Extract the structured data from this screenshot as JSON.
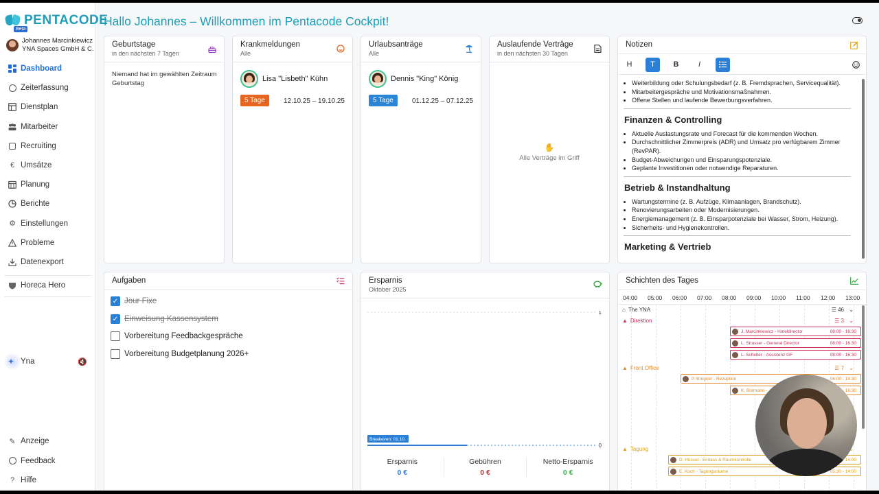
{
  "brand": {
    "name": "PENTACODE",
    "beta": "Beta"
  },
  "user": {
    "name": "Johannes Marcinkiewicz",
    "company": "YNA Spaces GmbH & C..."
  },
  "nav": [
    {
      "label": "Dashboard",
      "icon": "dashboard-icon",
      "active": true
    },
    {
      "label": "Zeiterfassung",
      "icon": "stopwatch-icon"
    },
    {
      "label": "Dienstplan",
      "icon": "table-icon"
    },
    {
      "label": "Mitarbeiter",
      "icon": "users-icon"
    },
    {
      "label": "Recruiting",
      "icon": "contact-icon"
    },
    {
      "label": "Umsätze",
      "icon": "euro-icon"
    },
    {
      "label": "Planung",
      "icon": "calendar-icon"
    },
    {
      "label": "Berichte",
      "icon": "pie-chart-icon"
    },
    {
      "label": "Einstellungen",
      "icon": "gear-icon"
    },
    {
      "label": "Probleme",
      "icon": "warning-icon"
    },
    {
      "label": "Datenexport",
      "icon": "download-icon"
    }
  ],
  "integration": {
    "label": "Horeca Hero",
    "icon": "shield-icon"
  },
  "assistant": {
    "label": "Yna",
    "icon": "sparkle-icon",
    "mute_icon": "mute-icon"
  },
  "bottom_nav": [
    {
      "label": "Anzeige",
      "icon": "brush-icon"
    },
    {
      "label": "Feedback",
      "icon": "chat-icon"
    },
    {
      "label": "Hilfe",
      "icon": "question-icon"
    }
  ],
  "page": {
    "title": "Hallo Johannes – Willkommen im Pentacode Cockpit!",
    "theme_icon": "toggle-icon"
  },
  "cards": {
    "birthdays": {
      "title": "Geburtstage",
      "subtitle": "in den nächsten 7 Tagen",
      "empty": "Niemand hat im gewählten Zeitraum Geburtstag",
      "icon": "cake-icon",
      "color": "#9b3fc7"
    },
    "sick": {
      "title": "Krankmeldungen",
      "subtitle": "Alle",
      "person": "Lisa \"Lisbeth\" Kühn",
      "badge": "5 Tage",
      "badge_color": "#e8651f",
      "range": "12.10.25 – 19.10.25",
      "icon": "sick-face-icon",
      "color": "#e8651f"
    },
    "vacation": {
      "title": "Urlaubsanträge",
      "subtitle": "Alle",
      "person": "Dennis \"King\" König",
      "badge": "5 Tage",
      "badge_color": "#2a85d6",
      "range": "01.12.25 – 07.12.25",
      "icon": "beach-icon",
      "color": "#2a85d6"
    },
    "contracts": {
      "title": "Auslaufende Verträge",
      "subtitle": "in den nächsten 30 Tagen",
      "empty": "Alle Verträge im Griff",
      "icon": "document-icon"
    },
    "notes": {
      "title": "Notizen",
      "toolbar": [
        "H",
        "T",
        "B",
        "I"
      ],
      "icon": "edit-icon",
      "sections": [
        {
          "heading": "",
          "items": [
            "Weiterbildung oder Schulungsbedarf (z. B. Fremdsprachen, Servicequalität).",
            "Mitarbeitergespräche und Motivationsmaßnahmen.",
            "Offene Stellen und laufende Bewerbungsverfahren."
          ]
        },
        {
          "heading": "Finanzen & Controlling",
          "items": [
            "Aktuelle Auslastungsrate und Forecast für die kommenden Wochen.",
            "Durchschnittlicher Zimmerpreis (ADR) und Umsatz pro verfügbarem Zimmer (RevPAR).",
            "Budget-Abweichungen und Einsparungspotenziale.",
            "Geplante Investitionen oder notwendige Reparaturen."
          ]
        },
        {
          "heading": "Betrieb & Instandhaltung",
          "items": [
            "Wartungstermine (z. B. Aufzüge, Klimaanlagen, Brandschutz).",
            "Renovierungsarbeiten oder Modernisierungen.",
            "Energiemanagement (z. B. Einsparpotenziale bei Wasser, Strom, Heizung).",
            "Sicherheits- und Hygienekontrollen."
          ]
        },
        {
          "heading": "Marketing & Vertrieb",
          "items": []
        }
      ]
    },
    "tasks": {
      "title": "Aufgaben",
      "icon": "checklist-icon",
      "items": [
        {
          "label": "Jour Fixe",
          "done": true
        },
        {
          "label": "Einweisung Kassensystem",
          "done": true
        },
        {
          "label": "Vorbereitung Feedbackgespräche",
          "done": false
        },
        {
          "label": "Vorbereitung Budgetplanung 2026+",
          "done": false
        }
      ]
    },
    "savings": {
      "title": "Ersparnis",
      "subtitle": "Oktober 2025",
      "icon": "piggy-bank-icon",
      "summary": [
        {
          "label": "Ersparnis",
          "value": "0 €",
          "color": "#2a7fd6"
        },
        {
          "label": "Gebühren",
          "value": "0 €",
          "color": "#c0303a"
        },
        {
          "label": "Netto-Ersparnis",
          "value": "0 €",
          "color": "#3cb34a"
        }
      ]
    },
    "shifts": {
      "title": "Schichten des Tages",
      "icon": "chart-icon",
      "hours": [
        "04:00",
        "05:00",
        "06:00",
        "07:00",
        "08:00",
        "09:00",
        "10:00",
        "11:00",
        "12:00",
        "13:00"
      ],
      "location": {
        "name": "The YNA",
        "count": "46"
      },
      "groups": [
        {
          "name": "Direktion",
          "count": "3",
          "color": "#c8325a",
          "shifts": [
            {
              "label": "J. Marcinkiewicz - Hoteldirector",
              "time": "08:00 - 16:30",
              "start": 8,
              "end": 16.5
            },
            {
              "label": "L. Strasser - General Director",
              "time": "08:00 - 16:30",
              "start": 8,
              "end": 16.5
            },
            {
              "label": "L. Schelter - Assistenz GF",
              "time": "08:00 - 16:30",
              "start": 8,
              "end": 16.5
            }
          ]
        },
        {
          "name": "Front Office",
          "count": "7",
          "color": "#e08a2c",
          "shifts": [
            {
              "label": "P. Brogner - Rezeption",
              "time": "06:00 - 14:30",
              "start": 6,
              "end": 14.5
            },
            {
              "label": "K. Bormann - ...",
              "time": "08:00 - 16:30",
              "start": 8,
              "end": 16.5
            }
          ]
        },
        {
          "name": "Tagung",
          "count": "",
          "color": "#d9a21a",
          "shifts": [
            {
              "label": "D. Hüssel - Eintass & Raumkontrolle",
              "time": "05:30 - 14:00",
              "start": 5.5,
              "end": 14
            },
            {
              "label": "E. Koch - Tagungsräume",
              "time": "05:30 - 14:00",
              "start": 5.5,
              "end": 14
            }
          ]
        }
      ]
    }
  },
  "chart_data": {
    "type": "line",
    "title": "Ersparnis",
    "subtitle": "Oktober 2025",
    "y_ticks": [
      "1",
      "0"
    ],
    "ylim": [
      0,
      1
    ],
    "series": [
      {
        "values": [
          0,
          0
        ]
      }
    ],
    "annotation": "Breakeven: 01.10.",
    "grid": true
  }
}
